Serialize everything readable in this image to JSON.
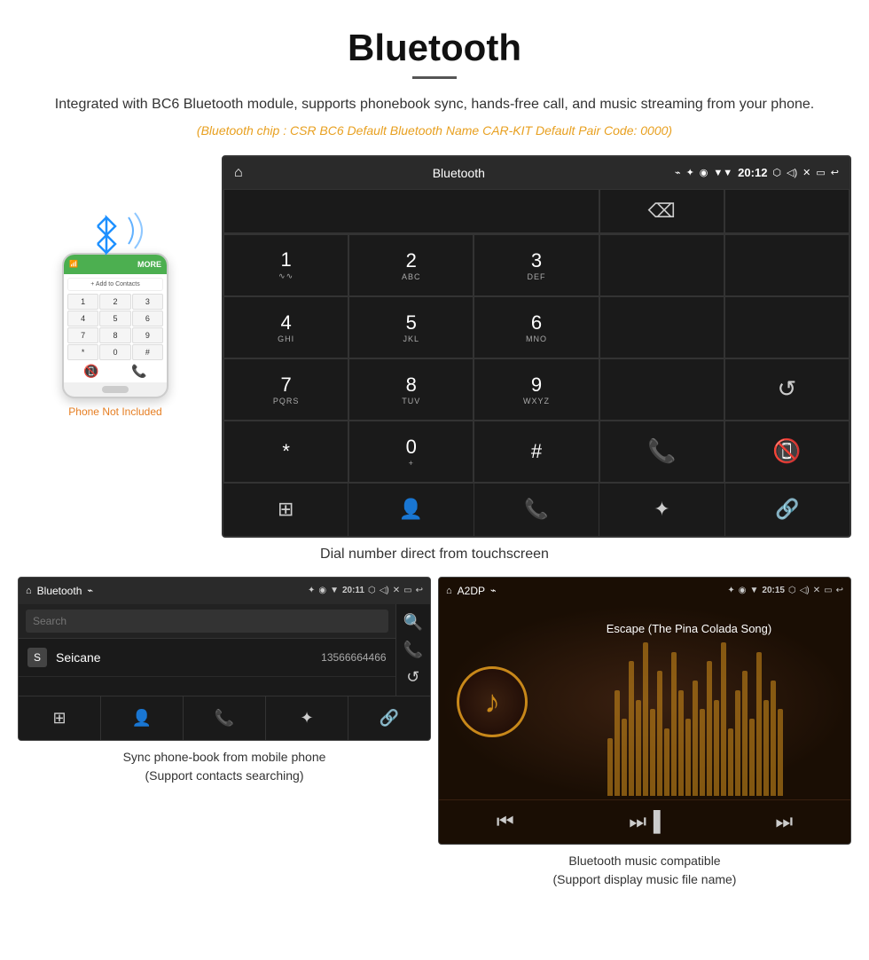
{
  "header": {
    "title": "Bluetooth",
    "description": "Integrated with BC6 Bluetooth module, supports phonebook sync, hands-free call, and music streaming from your phone.",
    "specs": "(Bluetooth chip : CSR BC6    Default Bluetooth Name CAR-KIT    Default Pair Code: 0000)"
  },
  "car_screen": {
    "status_bar": {
      "home_icon": "⌂",
      "title": "Bluetooth",
      "usb_icon": "⌁",
      "bt_icon": "✦",
      "location_icon": "◉",
      "signal_icon": "▼",
      "time": "20:12",
      "camera_icon": "⬡",
      "volume_icon": "◁",
      "x_icon": "✕",
      "rect_icon": "▭",
      "back_icon": "↩"
    },
    "dialpad": {
      "keys": [
        {
          "main": "1",
          "sub": ""
        },
        {
          "main": "2",
          "sub": "ABC"
        },
        {
          "main": "3",
          "sub": "DEF"
        },
        {
          "main": "",
          "sub": ""
        },
        {
          "main": "⌫",
          "sub": ""
        },
        {
          "main": "4",
          "sub": "GHI"
        },
        {
          "main": "5",
          "sub": "JKL"
        },
        {
          "main": "6",
          "sub": "MNO"
        },
        {
          "main": "",
          "sub": ""
        },
        {
          "main": "",
          "sub": ""
        },
        {
          "main": "7",
          "sub": "PQRS"
        },
        {
          "main": "8",
          "sub": "TUV"
        },
        {
          "main": "9",
          "sub": "WXYZ"
        },
        {
          "main": "",
          "sub": ""
        },
        {
          "main": "↺",
          "sub": ""
        },
        {
          "main": "*",
          "sub": ""
        },
        {
          "main": "0",
          "sub": "+"
        },
        {
          "main": "#",
          "sub": ""
        },
        {
          "main": "📞",
          "sub": ""
        },
        {
          "main": "📵",
          "sub": ""
        }
      ]
    },
    "bottom_nav": [
      "⊞",
      "👤",
      "📞",
      "✦",
      "🔗"
    ]
  },
  "subtitle": "Dial number direct from touchscreen",
  "phonebook": {
    "status_bar": {
      "home": "⌂",
      "title": "Bluetooth",
      "usb": "⌁",
      "bt": "✦",
      "loc": "◉",
      "sig": "▼",
      "time": "20:11",
      "cam": "⬡",
      "vol": "◁",
      "x": "✕",
      "rect": "▭",
      "back": "↩"
    },
    "search_placeholder": "Search",
    "contacts": [
      {
        "letter": "S",
        "name": "Seicane",
        "phone": "13566664466"
      }
    ],
    "side_icons": [
      "🔍",
      "📞",
      "↺"
    ],
    "bottom_nav": [
      "⊞",
      "👤",
      "📞",
      "✦",
      "🔗"
    ]
  },
  "music": {
    "status_bar": {
      "home": "⌂",
      "title": "A2DP",
      "usb": "⌁",
      "bt": "✦",
      "loc": "◉",
      "sig": "▼",
      "time": "20:15",
      "cam": "⬡",
      "vol": "◁",
      "x": "✕",
      "rect": "▭",
      "back": "↩"
    },
    "song_title": "Escape (The Pina Colada Song)",
    "controls": [
      "⏮",
      "⏭▐",
      "⏭"
    ]
  },
  "captions": {
    "phonebook": "Sync phone-book from mobile phone\n(Support contacts searching)",
    "music": "Bluetooth music compatible\n(Support display music file name)"
  },
  "phone_not_included": "Phone Not Included",
  "eq_bars": [
    30,
    55,
    40,
    70,
    50,
    80,
    45,
    65,
    35,
    75,
    55,
    40,
    60,
    45,
    70,
    50,
    80,
    35,
    55,
    65,
    40,
    75,
    50,
    60,
    45
  ]
}
